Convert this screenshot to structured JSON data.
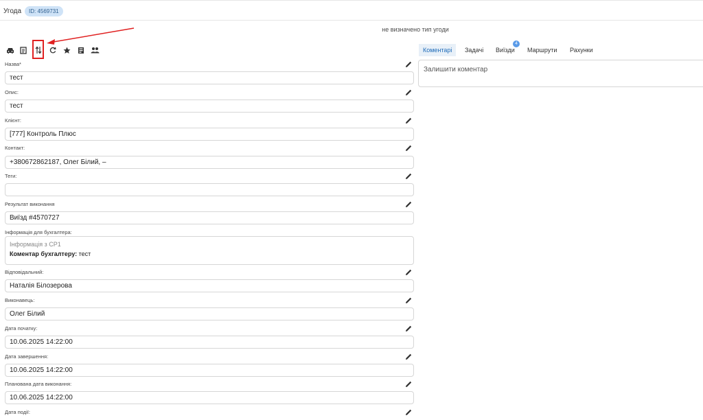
{
  "header": {
    "title": "Угода",
    "id_badge": "ID: 4569731",
    "deal_type": "не визначено тип угоди"
  },
  "toolbar": {
    "icons": [
      "car-icon",
      "document-icon",
      "swap-vertical-icon",
      "refresh-icon",
      "star-icon",
      "print-icon",
      "people-icon"
    ],
    "highlighted": "swap-vertical-icon"
  },
  "fields": [
    {
      "label": "Назва*",
      "value": "тест"
    },
    {
      "label": "Опис:",
      "value": "тест"
    },
    {
      "label": "Клієнт:",
      "value": "[777] Контроль Плюс"
    },
    {
      "label": "Контакт:",
      "value": "+380672862187, Олег Білий, –"
    },
    {
      "label": "Теги:",
      "value": ""
    },
    {
      "label": "Результат виконання",
      "value": "Виїзд #4570727"
    },
    {
      "label": "Інформація для бухгалтера:",
      "line1": "Інформація з СР1",
      "line2_bold": "Коментар бухгалтеру:",
      "line2_text": " тест"
    },
    {
      "label": "Відповідальний:",
      "value": "Наталія Білозерова"
    },
    {
      "label": "Виконавець:",
      "value": "Олег Білий"
    },
    {
      "label": "Дата початку:",
      "value": "10.06.2025 14:22:00"
    },
    {
      "label": "Дата завершення:",
      "value": "10.06.2025 14:22:00"
    },
    {
      "label": "Планована дата виконання:",
      "value": "10.06.2025 14:22:00"
    },
    {
      "label": "Дата події:",
      "value": ""
    }
  ],
  "tabs": [
    {
      "label": "Коментарі",
      "active": true
    },
    {
      "label": "Задачі",
      "active": false
    },
    {
      "label": "Виїзди",
      "active": false,
      "badge": "4"
    },
    {
      "label": "Маршрути",
      "active": false
    },
    {
      "label": "Рахунки",
      "active": false
    }
  ],
  "comment": {
    "placeholder": "Залишити коментар"
  },
  "colors": {
    "accent": "#1e6bb8",
    "badge": "#cfe3f7",
    "highlight": "#e02020"
  }
}
